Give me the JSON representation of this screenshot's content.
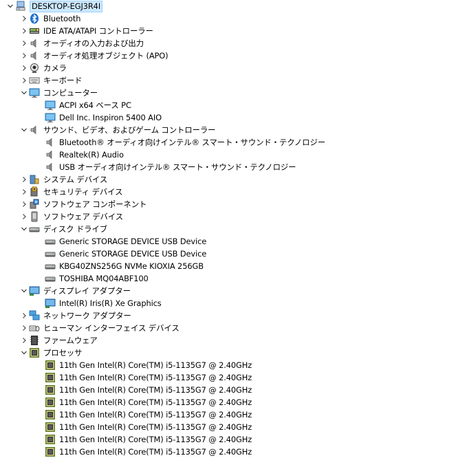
{
  "root": {
    "label": "DESKTOP-EGJ3R4I",
    "icon": "computer-icon",
    "expanded": true
  },
  "categories": [
    {
      "label": "Bluetooth",
      "icon": "bluetooth-icon",
      "expanded": false,
      "children": []
    },
    {
      "label": "IDE ATA/ATAPI コントローラー",
      "icon": "ide-controller-icon",
      "expanded": false,
      "children": []
    },
    {
      "label": "オーディオの入力および出力",
      "icon": "speaker-icon",
      "expanded": false,
      "children": []
    },
    {
      "label": "オーディオ処理オブジェクト (APO)",
      "icon": "speaker-icon",
      "expanded": false,
      "children": []
    },
    {
      "label": "カメラ",
      "icon": "camera-icon",
      "expanded": false,
      "children": []
    },
    {
      "label": "キーボード",
      "icon": "keyboard-icon",
      "expanded": false,
      "children": []
    },
    {
      "label": "コンピューター",
      "icon": "monitor-icon",
      "expanded": true,
      "children": [
        {
          "label": "ACPI x64 ベース PC",
          "icon": "monitor-icon"
        },
        {
          "label": "Dell Inc. Inspiron 5400 AIO",
          "icon": "monitor-icon"
        }
      ]
    },
    {
      "label": "サウンド、ビデオ、およびゲーム コントローラー",
      "icon": "speaker-icon",
      "expanded": true,
      "children": [
        {
          "label": "Bluetooth® オーディオ向けインテル® スマート・サウンド・テクノロジー",
          "icon": "speaker-icon"
        },
        {
          "label": "Realtek(R) Audio",
          "icon": "speaker-icon"
        },
        {
          "label": "USB オーディオ向けインテル® スマート・サウンド・テクノロジー",
          "icon": "speaker-icon"
        }
      ]
    },
    {
      "label": "システム デバイス",
      "icon": "system-device-icon",
      "expanded": false,
      "children": []
    },
    {
      "label": "セキュリティ デバイス",
      "icon": "security-device-icon",
      "expanded": false,
      "children": []
    },
    {
      "label": "ソフトウェア コンポーネント",
      "icon": "software-component-icon",
      "expanded": false,
      "children": []
    },
    {
      "label": "ソフトウェア デバイス",
      "icon": "software-device-icon",
      "expanded": false,
      "children": []
    },
    {
      "label": "ディスク ドライブ",
      "icon": "disk-drive-icon",
      "expanded": true,
      "children": [
        {
          "label": "Generic STORAGE DEVICE USB Device",
          "icon": "disk-drive-icon"
        },
        {
          "label": "Generic STORAGE DEVICE USB Device",
          "icon": "disk-drive-icon"
        },
        {
          "label": "KBG40ZNS256G NVMe KIOXIA 256GB",
          "icon": "disk-drive-icon"
        },
        {
          "label": "TOSHIBA MQ04ABF100",
          "icon": "disk-drive-icon"
        }
      ]
    },
    {
      "label": "ディスプレイ アダプター",
      "icon": "display-adapter-icon",
      "expanded": true,
      "children": [
        {
          "label": "Intel(R) Iris(R) Xe Graphics",
          "icon": "display-adapter-icon"
        }
      ]
    },
    {
      "label": "ネットワーク アダプター",
      "icon": "network-adapter-icon",
      "expanded": false,
      "children": []
    },
    {
      "label": "ヒューマン インターフェイス デバイス",
      "icon": "hid-icon",
      "expanded": false,
      "children": []
    },
    {
      "label": "ファームウェア",
      "icon": "firmware-icon",
      "expanded": false,
      "children": []
    },
    {
      "label": "プロセッサ",
      "icon": "processor-icon",
      "expanded": true,
      "children": [
        {
          "label": "11th Gen Intel(R) Core(TM) i5-1135G7 @ 2.40GHz",
          "icon": "processor-icon"
        },
        {
          "label": "11th Gen Intel(R) Core(TM) i5-1135G7 @ 2.40GHz",
          "icon": "processor-icon"
        },
        {
          "label": "11th Gen Intel(R) Core(TM) i5-1135G7 @ 2.40GHz",
          "icon": "processor-icon"
        },
        {
          "label": "11th Gen Intel(R) Core(TM) i5-1135G7 @ 2.40GHz",
          "icon": "processor-icon"
        },
        {
          "label": "11th Gen Intel(R) Core(TM) i5-1135G7 @ 2.40GHz",
          "icon": "processor-icon"
        },
        {
          "label": "11th Gen Intel(R) Core(TM) i5-1135G7 @ 2.40GHz",
          "icon": "processor-icon"
        },
        {
          "label": "11th Gen Intel(R) Core(TM) i5-1135G7 @ 2.40GHz",
          "icon": "processor-icon"
        },
        {
          "label": "11th Gen Intel(R) Core(TM) i5-1135G7 @ 2.40GHz",
          "icon": "processor-icon"
        }
      ]
    }
  ]
}
